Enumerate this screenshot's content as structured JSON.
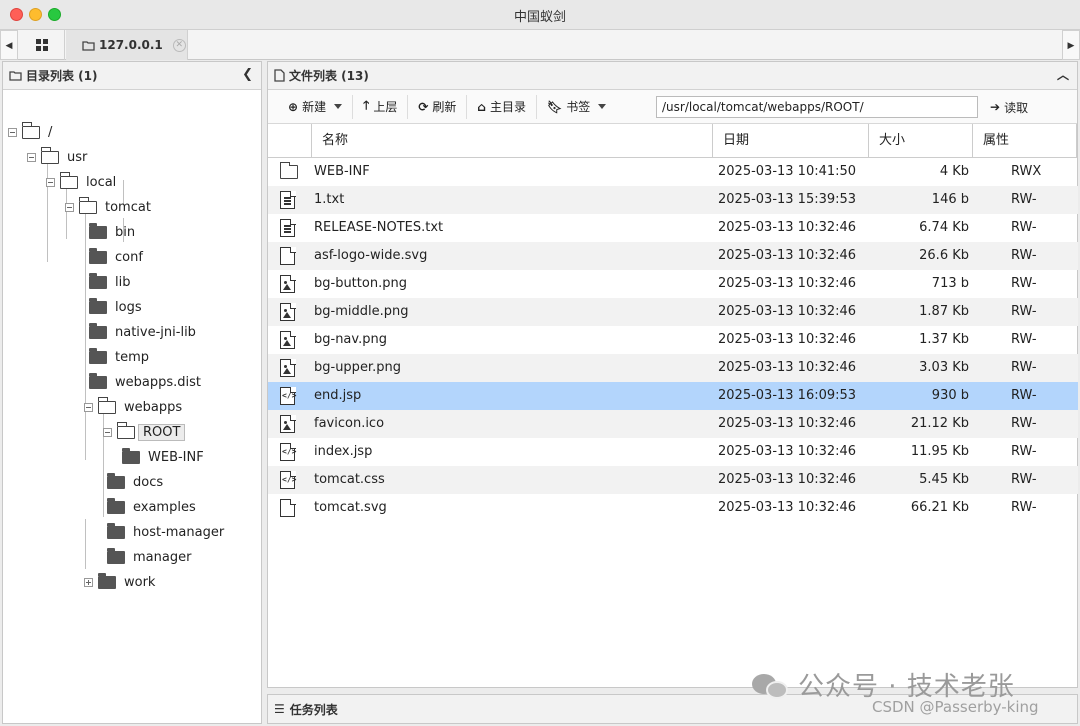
{
  "window": {
    "title": "中国蚁剑"
  },
  "tabs": [
    {
      "label": "127.0.0.1"
    }
  ],
  "dir_panel": {
    "title": "目录列表 (1)",
    "collapse_icon": "chevron-left-icon"
  },
  "tree": [
    {
      "label": "/",
      "state": "open",
      "expander": "minus"
    },
    {
      "label": "usr",
      "state": "open",
      "expander": "minus"
    },
    {
      "label": "local",
      "state": "open",
      "expander": "minus"
    },
    {
      "label": "tomcat",
      "state": "open",
      "expander": "minus"
    },
    {
      "label": "bin",
      "state": "closed"
    },
    {
      "label": "conf",
      "state": "closed"
    },
    {
      "label": "lib",
      "state": "closed"
    },
    {
      "label": "logs",
      "state": "closed"
    },
    {
      "label": "native-jni-lib",
      "state": "closed"
    },
    {
      "label": "temp",
      "state": "closed"
    },
    {
      "label": "webapps.dist",
      "state": "closed"
    },
    {
      "label": "webapps",
      "state": "open",
      "expander": "minus"
    },
    {
      "label": "ROOT",
      "state": "open",
      "expander": "minus",
      "selected": true
    },
    {
      "label": "WEB-INF",
      "state": "closed"
    },
    {
      "label": "docs",
      "state": "closed"
    },
    {
      "label": "examples",
      "state": "closed"
    },
    {
      "label": "host-manager",
      "state": "closed"
    },
    {
      "label": "manager",
      "state": "closed"
    },
    {
      "label": "work",
      "state": "closed",
      "expander": "plus"
    }
  ],
  "file_panel": {
    "title": "文件列表 (13)",
    "collapse_icon": "chevron-up-icon"
  },
  "toolbar": {
    "new_label": "新建",
    "up_label": "上层",
    "refresh_label": "刷新",
    "home_label": "主目录",
    "bookmark_label": "书签",
    "path_value": "/usr/local/tomcat/webapps/ROOT/",
    "read_label": "读取"
  },
  "columns": {
    "name": "名称",
    "date": "日期",
    "size": "大小",
    "attr": "属性"
  },
  "files": [
    {
      "name": "WEB-INF",
      "date": "2025-03-13 10:41:50",
      "size": "4 Kb",
      "attr": "RWX",
      "icon": "folder"
    },
    {
      "name": "1.txt",
      "date": "2025-03-13 15:39:53",
      "size": "146 b",
      "attr": "RW-",
      "icon": "text"
    },
    {
      "name": "RELEASE-NOTES.txt",
      "date": "2025-03-13 10:32:46",
      "size": "6.74 Kb",
      "attr": "RW-",
      "icon": "text"
    },
    {
      "name": "asf-logo-wide.svg",
      "date": "2025-03-13 10:32:46",
      "size": "26.6 Kb",
      "attr": "RW-",
      "icon": "file"
    },
    {
      "name": "bg-button.png",
      "date": "2025-03-13 10:32:46",
      "size": "713 b",
      "attr": "RW-",
      "icon": "image"
    },
    {
      "name": "bg-middle.png",
      "date": "2025-03-13 10:32:46",
      "size": "1.87 Kb",
      "attr": "RW-",
      "icon": "image"
    },
    {
      "name": "bg-nav.png",
      "date": "2025-03-13 10:32:46",
      "size": "1.37 Kb",
      "attr": "RW-",
      "icon": "image"
    },
    {
      "name": "bg-upper.png",
      "date": "2025-03-13 10:32:46",
      "size": "3.03 Kb",
      "attr": "RW-",
      "icon": "image"
    },
    {
      "name": "end.jsp",
      "date": "2025-03-13 16:09:53",
      "size": "930 b",
      "attr": "RW-",
      "icon": "code",
      "selected": true
    },
    {
      "name": "favicon.ico",
      "date": "2025-03-13 10:32:46",
      "size": "21.12 Kb",
      "attr": "RW-",
      "icon": "image"
    },
    {
      "name": "index.jsp",
      "date": "2025-03-13 10:32:46",
      "size": "11.95 Kb",
      "attr": "RW-",
      "icon": "code"
    },
    {
      "name": "tomcat.css",
      "date": "2025-03-13 10:32:46",
      "size": "5.45 Kb",
      "attr": "RW-",
      "icon": "code"
    },
    {
      "name": "tomcat.svg",
      "date": "2025-03-13 10:32:46",
      "size": "66.21 Kb",
      "attr": "RW-",
      "icon": "file"
    }
  ],
  "task_panel": {
    "title": "任务列表"
  },
  "watermark": {
    "text": "公众号 · 技术老张",
    "credit": "CSDN @Passerby-king"
  },
  "colors": {
    "selection": "#b3d5fc",
    "close": "#ff5f57",
    "minimize": "#febc2e",
    "maximize": "#28c840"
  }
}
